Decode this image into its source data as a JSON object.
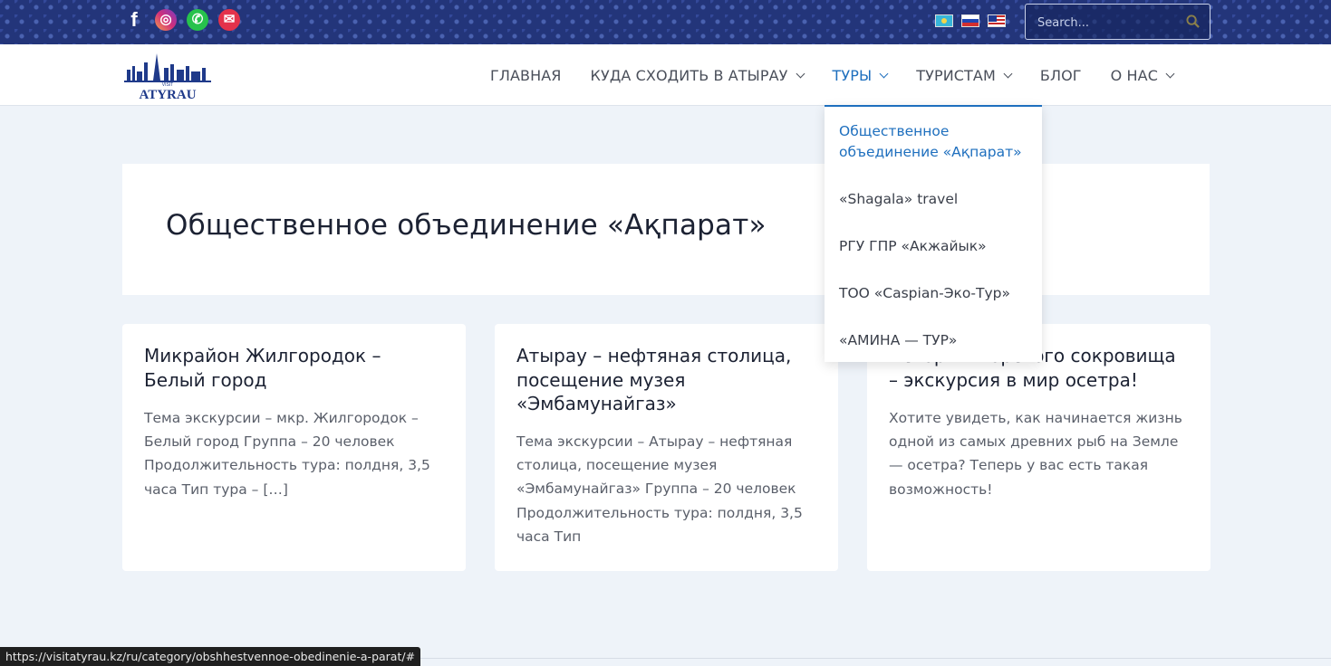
{
  "topbar": {
    "social": [
      {
        "icon": "facebook-icon",
        "glyph": "f"
      },
      {
        "icon": "instagram-icon",
        "glyph": "◎"
      },
      {
        "icon": "whatsapp-icon",
        "glyph": "✆"
      },
      {
        "icon": "mail-icon",
        "glyph": "✉"
      }
    ],
    "languages": [
      "kz",
      "ru",
      "en"
    ],
    "search": {
      "placeholder": "Search..."
    }
  },
  "header": {
    "logo": {
      "line1": "VISIT",
      "line2": "ATYRAU"
    },
    "nav": [
      {
        "label": "ГЛАВНАЯ",
        "has_dropdown": false
      },
      {
        "label": "КУДА СХОДИТЬ В АТЫРАУ",
        "has_dropdown": true
      },
      {
        "label": "ТУРЫ",
        "has_dropdown": true,
        "active": true
      },
      {
        "label": "ТУРИСТАМ",
        "has_dropdown": true
      },
      {
        "label": "БЛОГ",
        "has_dropdown": false
      },
      {
        "label": "О НАС",
        "has_dropdown": true
      }
    ]
  },
  "dropdown": {
    "items": [
      "Общественное объединение «Ақпарат»",
      "«Shagala» travel",
      "РГУ ГПР «Акжайык»",
      "ТОО «Caspian-Эко-Тур»",
      "«АМИНА — ТУР»"
    ]
  },
  "main": {
    "title": "Общественное объединение «Ақпарат»",
    "posts": [
      {
        "title": "Микрайон Жилгородок – Белый город",
        "excerpt": "Тема экскурсии – мкр. Жилгородок – Белый город Группа – 20 человек Продолжительность тура: полдня, 3,5 часа Тип тура – […]"
      },
      {
        "title": "Атырау – нефтяная столица, посещение музея «Эмбамунайгаз»",
        "excerpt": "Тема экскурсии – Атырау – нефтяная столица, посещение музея «Эмбамунайгаз» Группа – 20 человек Продолжительность тура: полдня, 3,5 часа Тип"
      },
      {
        "title": "История Морского сокровища – экскурсия в мир осетра!",
        "excerpt": "Хотите увидеть, как начинается жизнь одной из самых древних рыб на Земле — осетра? Теперь у вас есть такая возможность!"
      }
    ]
  },
  "status_url": "https://visitatyrau.kz/ru/category/obshhestvennoe-obedinenie-a-parat/#",
  "colors": {
    "accent": "#1e6fbe",
    "topbar": "#23357a",
    "background": "#eef3f9"
  }
}
